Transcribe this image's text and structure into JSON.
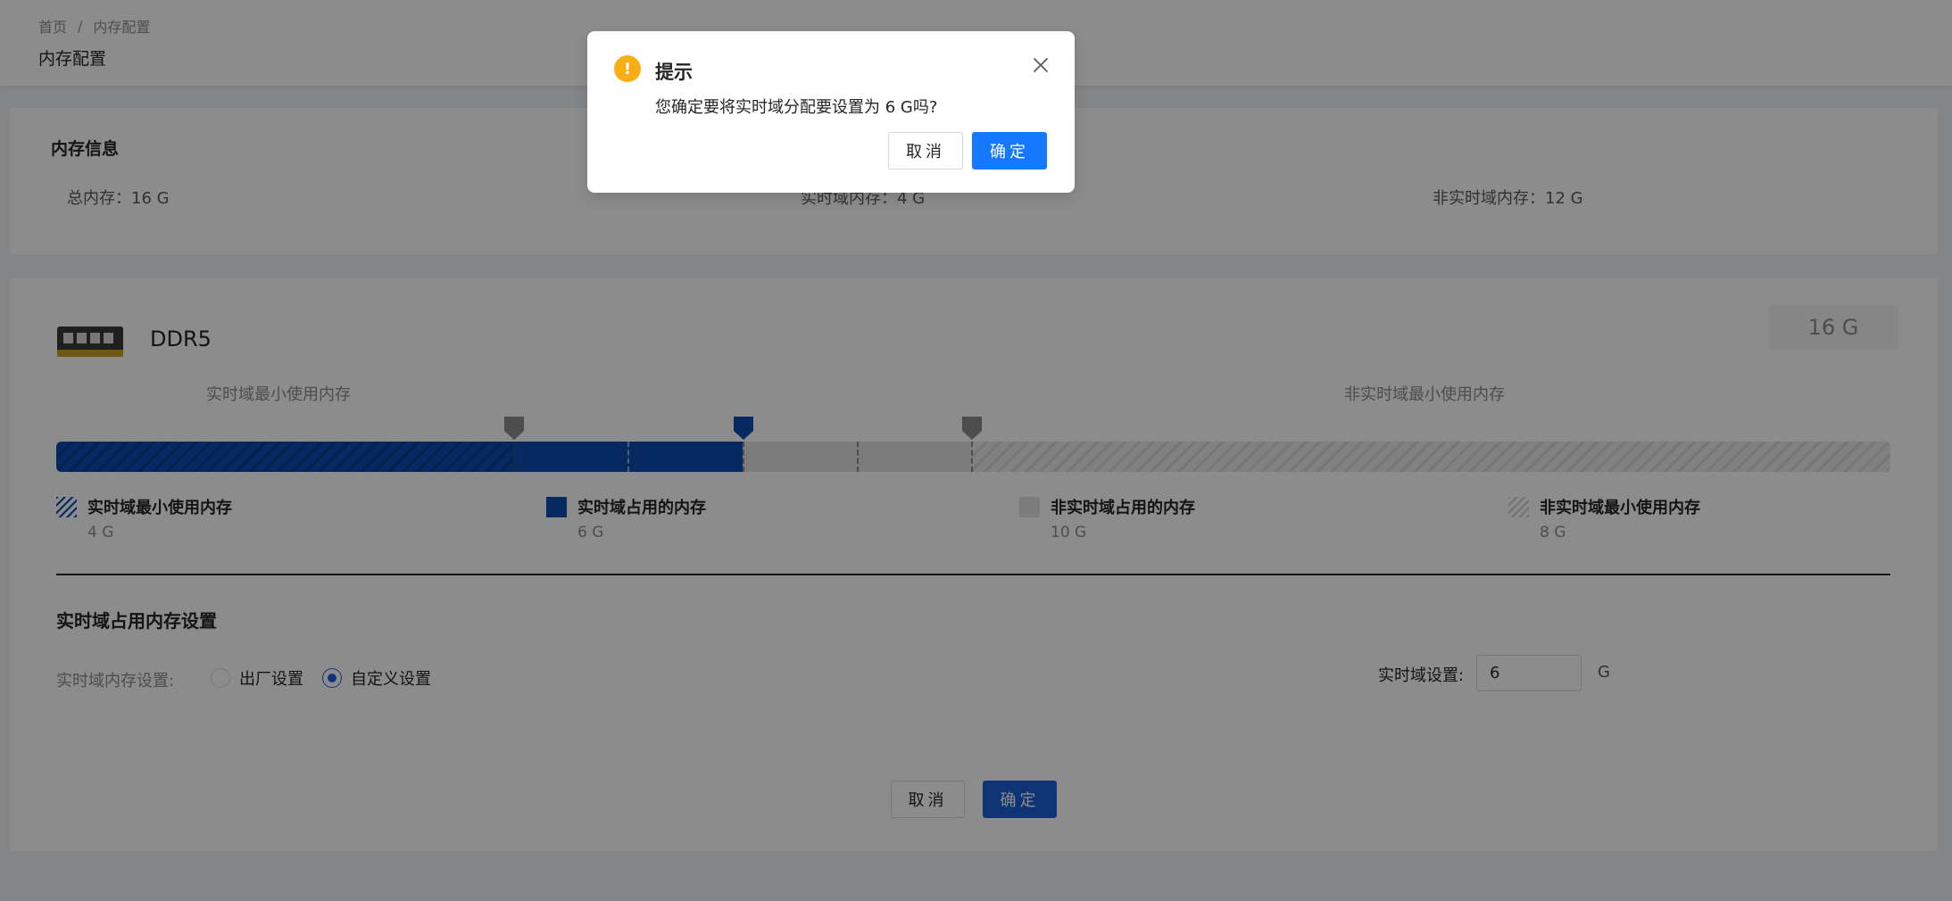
{
  "breadcrumb": {
    "home": "首页",
    "separator": "/",
    "current": "内存配置"
  },
  "page": {
    "title": "内存配置"
  },
  "memory_info": {
    "title": "内存信息",
    "total": "总内存：16 G",
    "realtime": "实时域内存：4 G",
    "non_realtime": "非实时域内存：12 G"
  },
  "module": {
    "type": "DDR5",
    "total_badge": "16 G",
    "axis_left_label": "实时域最小使用内存",
    "axis_right_label": "非实时域最小使用内存",
    "bar": {
      "total_gb": 16,
      "segments": [
        {
          "key": "realtime_min",
          "gb": 4
        },
        {
          "key": "realtime_used_extra",
          "gb": 2
        },
        {
          "key": "nonrealtime_used_extra",
          "gb": 2
        },
        {
          "key": "nonrealtime_min",
          "gb": 8
        }
      ],
      "handles_gb": [
        4,
        6,
        8
      ],
      "active_handle_gb": 6,
      "colors": {
        "realtime": "#0b4bb3",
        "nonrealtime": "#e2e2e2",
        "handle_active": "#0b4bb3",
        "handle_inactive": "#8c8c8c"
      }
    },
    "legend": [
      {
        "name": "实时域最小使用内存",
        "value": "4 G"
      },
      {
        "name": "实时域占用的内存",
        "value": "6 G"
      },
      {
        "name": "非实时域占用的内存",
        "value": "10 G"
      },
      {
        "name": "非实时域最小使用内存",
        "value": "8 G"
      }
    ]
  },
  "settings": {
    "section_title": "实时域占用内存设置",
    "mode_label": "实时域内存设置:",
    "mode_options": [
      {
        "label": "出厂设置",
        "selected": false
      },
      {
        "label": "自定义设置",
        "selected": true
      }
    ],
    "realtime_label": "实时域设置:",
    "realtime_value": "6",
    "unit": "G"
  },
  "actions": {
    "cancel": "取消",
    "ok": "确定"
  },
  "dialog": {
    "title": "提示",
    "message": "您确定要将实时域分配要设置为 6 G吗?",
    "cancel": "取消",
    "ok": "确定",
    "icon": "warning-icon",
    "accent": "#faad14"
  }
}
